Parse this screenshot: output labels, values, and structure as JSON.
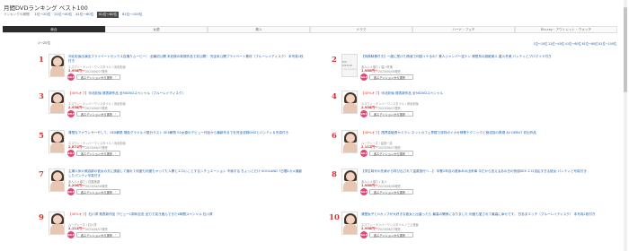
{
  "page": {
    "title": "月間DVDランキング ベスト100"
  },
  "range": {
    "label": "ランキングの期間",
    "links": [
      {
        "label": "1位〜20位",
        "active": false
      },
      {
        "label": "21位〜40位",
        "active": false
      },
      {
        "label": "41位〜60位",
        "active": false
      },
      {
        "label": "61位〜80位",
        "active": true
      },
      {
        "label": "81位〜100位",
        "active": false
      }
    ]
  },
  "tabs": [
    {
      "label": "総合",
      "active": true
    },
    {
      "label": "女優",
      "active": false
    },
    {
      "label": "素人",
      "active": false
    },
    {
      "label": "ドラマ",
      "active": false
    },
    {
      "label": "ハード・フェチ",
      "active": false
    },
    {
      "label": "Blu-ray・アウトレット・ウォッチ",
      "active": false
    }
  ],
  "list": {
    "count_text": "1〜20位",
    "sort_links": [
      "1位〜20位",
      "21位〜40位",
      "41位〜60位",
      "61位〜80位",
      "81位〜100位"
    ]
  },
  "items": [
    {
      "rank": "1",
      "tag": "",
      "title": "河北彩伽出演全プライベートセックス自撮りムービー！ 全編初公開 未収録の新規作品で初公開！ 完全未公開プライベート素材（ブルーレイディスク） 本写真1枚付き",
      "meta": "エスワン・ナンバーワンスタイル / 河北彩伽",
      "price": "2,958円〜",
      "date": "2023/06/07発売",
      "sale": "SALE",
      "button": "各エディションから選択",
      "thumb": "photo"
    },
    {
      "rank": "2",
      "tag": "",
      "title": "【特典映像付き】一度に受けた精液で何回イケるの？素人ジャンパー逆ナン 清楚系の超絶美人 星川冬美 パンティとブロマイド付き",
      "meta": "素人ハメ撮り / 星川冬美",
      "price": "1,980円〜",
      "date": "2023/06/08発売",
      "sale": "SALE",
      "button": "各エディションから選択",
      "thumb": "noimage",
      "noimg_text": "NO IMAGE",
      "noimg_sub": "now printing"
    },
    {
      "rank": "3",
      "tag": "【40%オフ】",
      "title": "河北彩伽 発表新作品 全50DVDスペシャル（ブルーレイディスク）",
      "meta": "エスワン・ナンバーワンスタイル / 河北彩伽",
      "price": "2,958円〜",
      "date": "2023/06/07発売",
      "sale": "SALE",
      "button": "各エディションから選択",
      "thumb": "photo"
    },
    {
      "rank": "4",
      "tag": "【40%オフ】",
      "title": "河北彩伽 発表新作品 全50DVDスペシャル",
      "meta": "エスワン・ナンバーワンスタイル / 河北彩伽",
      "price": "2,958円〜",
      "date": "2023/06/07発売",
      "sale": "SALE",
      "button": "各エディションから選択",
      "thumb": "photo"
    },
    {
      "rank": "5",
      "tag": "",
      "title": "清楚なアナウンサーそして、SEX解禁 現役グラドル十数分ラスト SEX解禁 S1女優のデビュー作品から最新作までを完全収録DVDとパンティ＆写真付き",
      "meta": "エスワン・ナンバーワンスタイル / 河北彩伽",
      "price": "2,871円〜",
      "date": "2023/06/07発売",
      "sale": "SALE",
      "button": "各エディションから選択",
      "thumb": "photo"
    },
    {
      "rank": "6",
      "tag": "【40%オフ】",
      "title": "限界突破再ヤミラン ネットカフェ界隈で評判のイカセ神業テクニックと極淫技の再現 AV DEBUT 初出作品",
      "meta": "ムーディーズ / 星宮一花",
      "price": "2,112円〜",
      "date": "2023/06/07発売",
      "sale": "SALE",
      "button": "各エディションから選択",
      "thumb": "photo"
    },
    {
      "rank": "7",
      "tag": "",
      "title": "主婦人気の美容師の彼女の夫に誘惑して隠れて何度も何度もヤってた人妻とエロいことするシチュエーション 不倫する ちょっとだけ SOOLAND 7日間2カメ撮影したパンティ写真付き",
      "meta": "素人ハメ撮り / 佐藤美優",
      "price": "2,200円〜",
      "date": "2023/06/08発売",
      "sale": "SALE",
      "button": "各エディションから選択",
      "thumb": "photo"
    },
    {
      "rank": "8",
      "tag": "",
      "title": "【学生時代の先輩から呼び出されて温泉旅行へ…】 卒業2年目の夏休みの出来事 今だから言えるあの日の快感SEX エロ淫乱すぎる彼女 パンティと写真付き",
      "meta": "素人ハメ撮り / 素人",
      "price": "1,980円〜",
      "date": "2023/06/08発売",
      "sale": "SALE",
      "button": "各エディションから選択",
      "thumb": "photo"
    },
    {
      "rank": "9",
      "tag": "【40%オフ】",
      "title": "石川澪 発表新作品 デビュー1周年記念 全力で突き進んできた4時間スペシャル 石川澪",
      "meta": "ムーディーズ / 石川澪",
      "price": "2,112円〜",
      "date": "2023/06/07発売",
      "sale": "SALE",
      "button": "各エディションから選択",
      "thumb": "photo"
    },
    {
      "rank": "10",
      "tag": "",
      "title": "清楚女子とGカップが大好きな彼女と出逢ったら 最高の関係になりました 何度も愛されて最高に幸せです。 甘あまエッチ（ブルーレイディスク） 本写真1枚付き",
      "meta": "エスワン・ナンバーワンスタイル / 三上悠亜",
      "price": "2,958円〜",
      "date": "2023/06/07発売",
      "sale": "SALE",
      "button": "各エディションから選択",
      "thumb": "photo"
    }
  ],
  "colors": {
    "rank": "#d43333",
    "link": "#1b5fab",
    "tag": "#e0321f",
    "sale": "#e04a74",
    "active_tab": "#2b2b2b"
  }
}
